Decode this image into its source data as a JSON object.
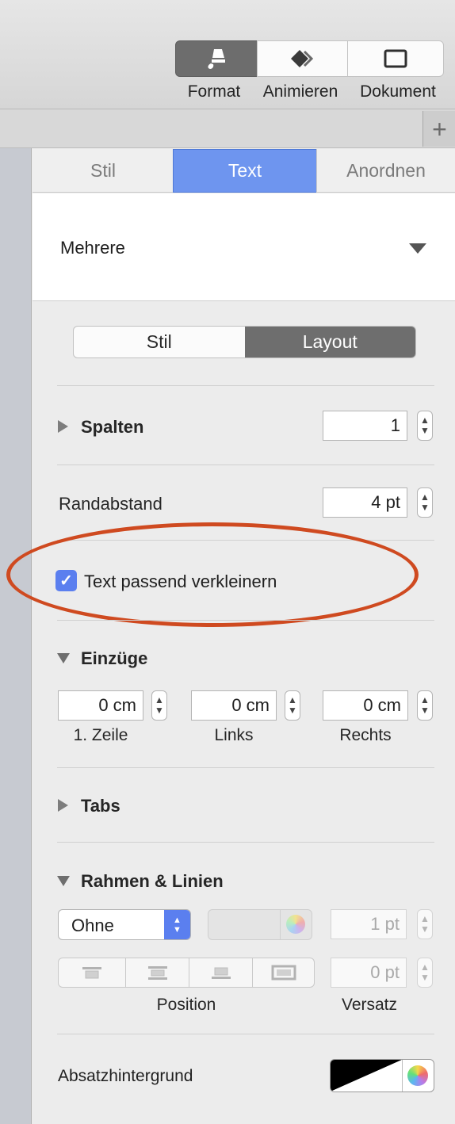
{
  "toolbar": {
    "buttons": [
      {
        "label": "Format",
        "icon": "paintbrush-icon"
      },
      {
        "label": "Animieren",
        "icon": "diamond-animate-icon"
      },
      {
        "label": "Dokument",
        "icon": "document-icon"
      }
    ],
    "plus": "+"
  },
  "tabs": [
    "Stil",
    "Text",
    "Anordnen"
  ],
  "active_tab": "Text",
  "paragraph_style": {
    "value": "Mehrere"
  },
  "segment": {
    "left": "Stil",
    "right": "Layout",
    "selected": "Layout"
  },
  "spalten": {
    "label": "Spalten",
    "value": "1"
  },
  "randabstand": {
    "label": "Randabstand",
    "value": "4 pt"
  },
  "shrink": {
    "label": "Text passend verkleinern",
    "checked": true
  },
  "einzuege": {
    "label": "Einzüge",
    "fields": [
      {
        "value": "0 cm",
        "label": "1. Zeile"
      },
      {
        "value": "0 cm",
        "label": "Links"
      },
      {
        "value": "0 cm",
        "label": "Rechts"
      }
    ]
  },
  "tabs_section": {
    "label": "Tabs"
  },
  "rahmen": {
    "label": "Rahmen & Linien",
    "style_value": "Ohne",
    "width_value": "1 pt",
    "offset_value": "0 pt",
    "position_label": "Position",
    "offset_label": "Versatz"
  },
  "absatz": {
    "label": "Absatzhintergrund"
  },
  "colors": {
    "accent": "#6e95ef",
    "highlight_oval": "#cf4a20",
    "checkbox": "#5b7fef"
  }
}
